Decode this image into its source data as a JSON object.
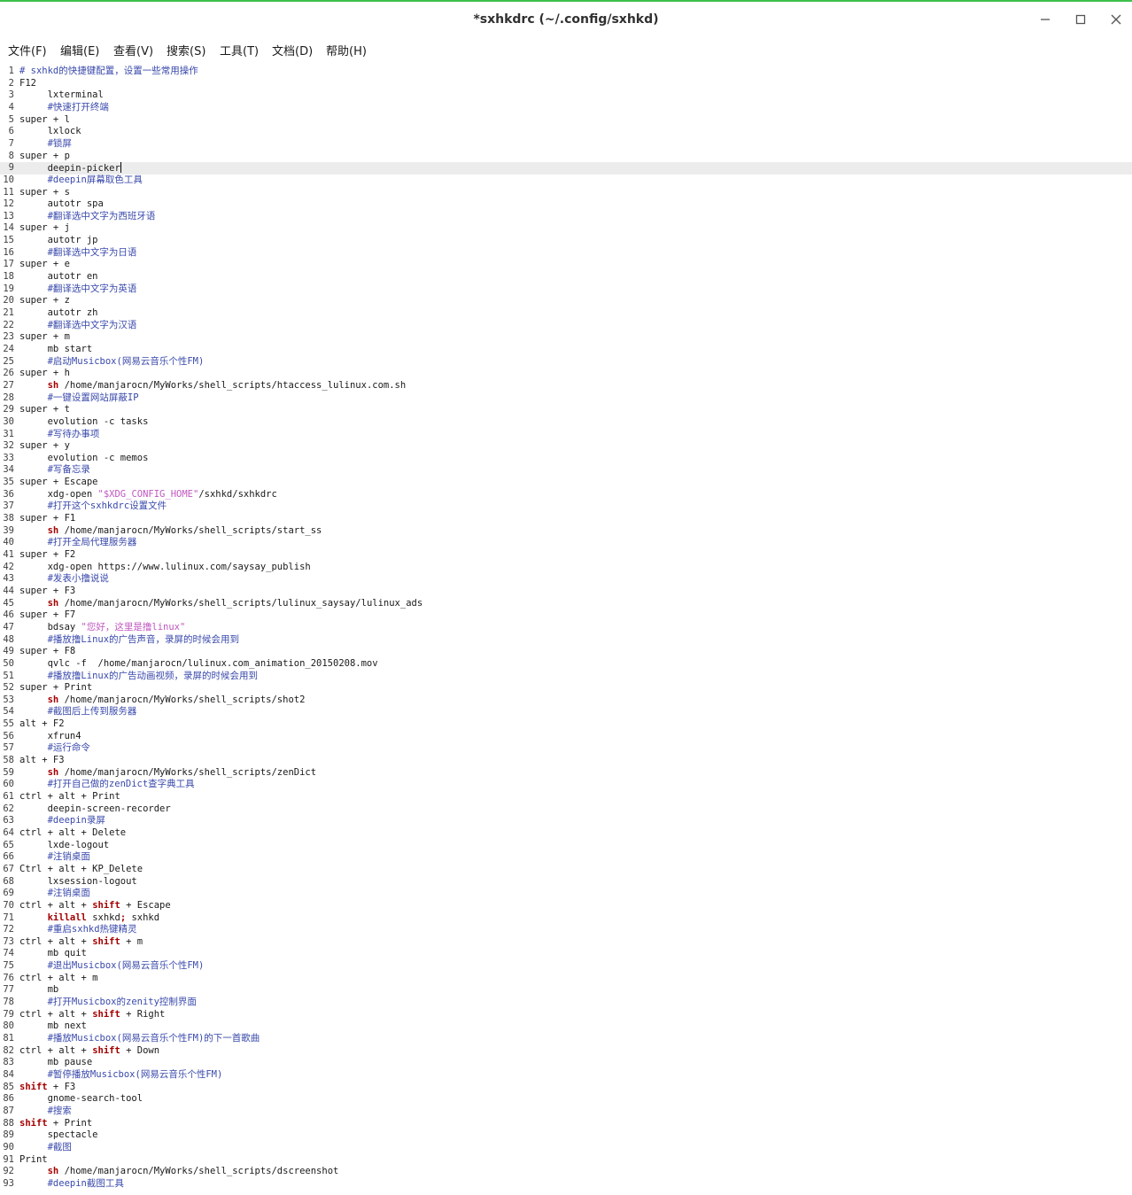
{
  "window": {
    "title": "*sxhkdrc (~/.config/sxhkd)",
    "accent_color": "#3cc04a"
  },
  "menu": [
    {
      "label": "文件(F)"
    },
    {
      "label": "编辑(E)"
    },
    {
      "label": "查看(V)"
    },
    {
      "label": "搜索(S)"
    },
    {
      "label": "工具(T)"
    },
    {
      "label": "文档(D)"
    },
    {
      "label": "帮助(H)"
    }
  ],
  "editor": {
    "current_line": 9,
    "colors": {
      "comment": "#3949ab",
      "keyword": "#a40000",
      "string": "#c058c0",
      "current_line_bg": "#ececec"
    },
    "lines": [
      [
        [
          "# sxhkd的快捷键配置，设置一些常用操作",
          "comment"
        ]
      ],
      [
        [
          "F12",
          ""
        ]
      ],
      [
        [
          "     lxterminal",
          ""
        ]
      ],
      [
        [
          "     ",
          ""
        ],
        [
          "#快速打开终端",
          "comment"
        ]
      ],
      [
        [
          "super + l",
          ""
        ]
      ],
      [
        [
          "     lxlock",
          ""
        ]
      ],
      [
        [
          "     ",
          ""
        ],
        [
          "#锁屏",
          "comment"
        ]
      ],
      [
        [
          "super + p",
          ""
        ]
      ],
      [
        [
          "     deepin-picker",
          ""
        ]
      ],
      [
        [
          "     ",
          ""
        ],
        [
          "#deepin屏幕取色工具",
          "comment"
        ]
      ],
      [
        [
          "super + s",
          ""
        ]
      ],
      [
        [
          "     autotr spa",
          ""
        ]
      ],
      [
        [
          "     ",
          ""
        ],
        [
          "#翻译选中文字为西班牙语",
          "comment"
        ]
      ],
      [
        [
          "super + j",
          ""
        ]
      ],
      [
        [
          "     autotr jp",
          ""
        ]
      ],
      [
        [
          "     ",
          ""
        ],
        [
          "#翻译选中文字为日语",
          "comment"
        ]
      ],
      [
        [
          "super + e",
          ""
        ]
      ],
      [
        [
          "     autotr en",
          ""
        ]
      ],
      [
        [
          "     ",
          ""
        ],
        [
          "#翻译选中文字为英语",
          "comment"
        ]
      ],
      [
        [
          "super + z",
          ""
        ]
      ],
      [
        [
          "     autotr zh",
          ""
        ]
      ],
      [
        [
          "     ",
          ""
        ],
        [
          "#翻译选中文字为汉语",
          "comment"
        ]
      ],
      [
        [
          "super + m",
          ""
        ]
      ],
      [
        [
          "     mb start",
          ""
        ]
      ],
      [
        [
          "     ",
          ""
        ],
        [
          "#启动Musicbox(网易云音乐个性FM)",
          "comment"
        ]
      ],
      [
        [
          "super + h",
          ""
        ]
      ],
      [
        [
          "     ",
          ""
        ],
        [
          "sh",
          "keyword"
        ],
        [
          " /home/manjarocn/MyWorks/shell_scripts/htaccess_lulinux.com.sh",
          ""
        ]
      ],
      [
        [
          "     ",
          ""
        ],
        [
          "#一键设置网站屏蔽IP",
          "comment"
        ]
      ],
      [
        [
          "super + t",
          ""
        ]
      ],
      [
        [
          "     evolution -c tasks",
          ""
        ]
      ],
      [
        [
          "     ",
          ""
        ],
        [
          "#写待办事项",
          "comment"
        ]
      ],
      [
        [
          "super + y",
          ""
        ]
      ],
      [
        [
          "     evolution -c memos",
          ""
        ]
      ],
      [
        [
          "     ",
          ""
        ],
        [
          "#写备忘录",
          "comment"
        ]
      ],
      [
        [
          "super + Escape",
          ""
        ]
      ],
      [
        [
          "     xdg-open ",
          ""
        ],
        [
          "\"$XDG_CONFIG_HOME\"",
          "string"
        ],
        [
          "/sxhkd/sxhkdrc",
          ""
        ]
      ],
      [
        [
          "     ",
          ""
        ],
        [
          "#打开这个sxhkdrc设置文件",
          "comment"
        ]
      ],
      [
        [
          "super + F1",
          ""
        ]
      ],
      [
        [
          "     ",
          ""
        ],
        [
          "sh",
          "keyword"
        ],
        [
          " /home/manjarocn/MyWorks/shell_scripts/start_ss",
          ""
        ]
      ],
      [
        [
          "     ",
          ""
        ],
        [
          "#打开全局代理服务器",
          "comment"
        ]
      ],
      [
        [
          "super + F2",
          ""
        ]
      ],
      [
        [
          "     xdg-open https://www.lulinux.com/saysay_publish",
          ""
        ]
      ],
      [
        [
          "     ",
          ""
        ],
        [
          "#发表小撸说说",
          "comment"
        ]
      ],
      [
        [
          "super + F3",
          ""
        ]
      ],
      [
        [
          "     ",
          ""
        ],
        [
          "sh",
          "keyword"
        ],
        [
          " /home/manjarocn/MyWorks/shell_scripts/lulinux_saysay/lulinux_ads",
          ""
        ]
      ],
      [
        [
          "super + F7",
          ""
        ]
      ],
      [
        [
          "     bdsay ",
          ""
        ],
        [
          "\"您好，这里是撸linux\"",
          "string"
        ]
      ],
      [
        [
          "     ",
          ""
        ],
        [
          "#播放撸Linux的广告声音，录屏的时候会用到",
          "comment"
        ]
      ],
      [
        [
          "super + F8",
          ""
        ]
      ],
      [
        [
          "     qvlc -f  /home/manjarocn/lulinux.com_animation_20150208.mov",
          ""
        ]
      ],
      [
        [
          "     ",
          ""
        ],
        [
          "#播放撸Linux的广告动画视频，录屏的时候会用到",
          "comment"
        ]
      ],
      [
        [
          "super + Print",
          ""
        ]
      ],
      [
        [
          "     ",
          ""
        ],
        [
          "sh",
          "keyword"
        ],
        [
          " /home/manjarocn/MyWorks/shell_scripts/shot2",
          ""
        ]
      ],
      [
        [
          "     ",
          ""
        ],
        [
          "#截图后上传到服务器",
          "comment"
        ]
      ],
      [
        [
          "alt + F2",
          ""
        ]
      ],
      [
        [
          "     xfrun4",
          ""
        ]
      ],
      [
        [
          "     ",
          ""
        ],
        [
          "#运行命令",
          "comment"
        ]
      ],
      [
        [
          "alt + F3",
          ""
        ]
      ],
      [
        [
          "     ",
          ""
        ],
        [
          "sh",
          "keyword"
        ],
        [
          " /home/manjarocn/MyWorks/shell_scripts/zenDict",
          ""
        ]
      ],
      [
        [
          "     ",
          ""
        ],
        [
          "#打开自己做的zenDict查字典工具",
          "comment"
        ]
      ],
      [
        [
          "ctrl + alt + Print",
          ""
        ]
      ],
      [
        [
          "     deepin-screen-recorder",
          ""
        ]
      ],
      [
        [
          "     ",
          ""
        ],
        [
          "#deepin录屏",
          "comment"
        ]
      ],
      [
        [
          "ctrl + alt + Delete",
          ""
        ]
      ],
      [
        [
          "     lxde-logout",
          ""
        ]
      ],
      [
        [
          "     ",
          ""
        ],
        [
          "#注销桌面",
          "comment"
        ]
      ],
      [
        [
          "Ctrl + alt + KP_Delete",
          ""
        ]
      ],
      [
        [
          "     lxsession-logout",
          ""
        ]
      ],
      [
        [
          "     ",
          ""
        ],
        [
          "#注销桌面",
          "comment"
        ]
      ],
      [
        [
          "ctrl + alt + ",
          ""
        ],
        [
          "shift",
          "keyword"
        ],
        [
          " + Escape",
          ""
        ]
      ],
      [
        [
          "     ",
          ""
        ],
        [
          "killall",
          "keyword"
        ],
        [
          " sxhkd",
          ""
        ],
        [
          ";",
          "keyword"
        ],
        [
          " sxhkd",
          ""
        ]
      ],
      [
        [
          "     ",
          ""
        ],
        [
          "#重启sxhkd热键精灵",
          "comment"
        ]
      ],
      [
        [
          "ctrl + alt + ",
          ""
        ],
        [
          "shift",
          "keyword"
        ],
        [
          " + m",
          ""
        ]
      ],
      [
        [
          "     mb quit",
          ""
        ]
      ],
      [
        [
          "     ",
          ""
        ],
        [
          "#退出Musicbox(网易云音乐个性FM)",
          "comment"
        ]
      ],
      [
        [
          "ctrl + alt + m",
          ""
        ]
      ],
      [
        [
          "     mb",
          ""
        ]
      ],
      [
        [
          "     ",
          ""
        ],
        [
          "#打开Musicbox的zenity控制界面",
          "comment"
        ]
      ],
      [
        [
          "ctrl + alt + ",
          ""
        ],
        [
          "shift",
          "keyword"
        ],
        [
          " + Right",
          ""
        ]
      ],
      [
        [
          "     mb next",
          ""
        ]
      ],
      [
        [
          "     ",
          ""
        ],
        [
          "#播放Musicbox(网易云音乐个性FM)的下一首歌曲",
          "comment"
        ]
      ],
      [
        [
          "ctrl + alt + ",
          ""
        ],
        [
          "shift",
          "keyword"
        ],
        [
          " + Down",
          ""
        ]
      ],
      [
        [
          "     mb pause",
          ""
        ]
      ],
      [
        [
          "     ",
          ""
        ],
        [
          "#暂停播放Musicbox(网易云音乐个性FM)",
          "comment"
        ]
      ],
      [
        [
          "shift",
          "keyword"
        ],
        [
          " + F3",
          ""
        ]
      ],
      [
        [
          "     gnome-search-tool",
          ""
        ]
      ],
      [
        [
          "     ",
          ""
        ],
        [
          "#搜索",
          "comment"
        ]
      ],
      [
        [
          "shift",
          "keyword"
        ],
        [
          " + Print",
          ""
        ]
      ],
      [
        [
          "     spectacle",
          ""
        ]
      ],
      [
        [
          "     ",
          ""
        ],
        [
          "#截图",
          "comment"
        ]
      ],
      [
        [
          "Print",
          ""
        ]
      ],
      [
        [
          "     ",
          ""
        ],
        [
          "sh",
          "keyword"
        ],
        [
          " /home/manjarocn/MyWorks/shell_scripts/dscreenshot",
          ""
        ]
      ],
      [
        [
          "     ",
          ""
        ],
        [
          "#deepin截图工具",
          "comment"
        ]
      ]
    ]
  }
}
